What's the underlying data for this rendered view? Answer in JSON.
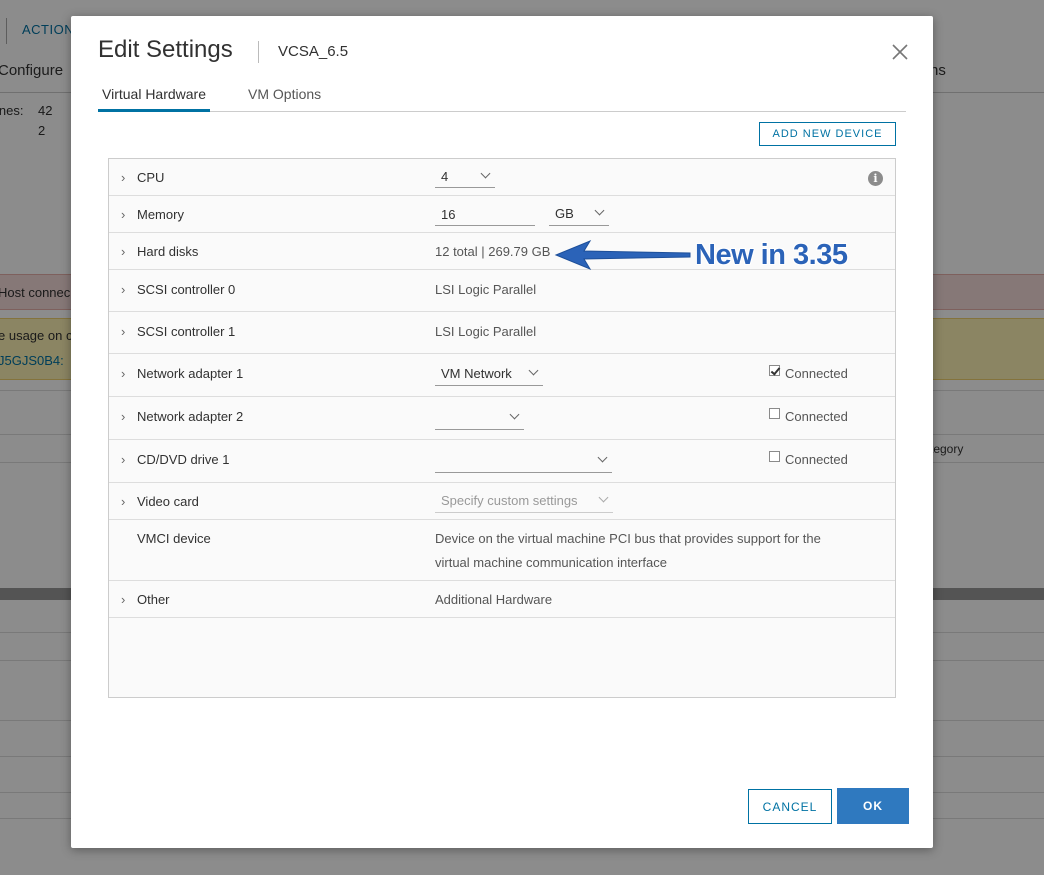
{
  "background": {
    "actions_label": "ACTION",
    "configure_tab": "Configure",
    "permissions_tab_fragment": "ns",
    "stat1_label": "ines:",
    "stat1_value": "42",
    "stat2_value": "2",
    "alert_red_text": "Host connec",
    "alert_yellow_text": "e usage on c",
    "alert_yellow_link": "J5GJS0B4:",
    "category_header": "tegory"
  },
  "modal": {
    "title": "Edit Settings",
    "subtitle": "VCSA_6.5",
    "close_icon": "close-icon",
    "tabs": [
      {
        "label": "Virtual Hardware",
        "active": true
      },
      {
        "label": "VM Options",
        "active": false
      }
    ],
    "add_device_label": "ADD NEW DEVICE",
    "hardware": {
      "cpu": {
        "label": "CPU",
        "value": "4"
      },
      "memory": {
        "label": "Memory",
        "value": "16",
        "unit": "GB"
      },
      "hard_disks": {
        "label": "Hard disks",
        "value": "12 total | 269.79 GB"
      },
      "scsi0": {
        "label": "SCSI controller 0",
        "value": "LSI Logic Parallel"
      },
      "scsi1": {
        "label": "SCSI controller 1",
        "value": "LSI Logic Parallel"
      },
      "net1": {
        "label": "Network adapter 1",
        "value": "VM Network",
        "connected_label": "Connected",
        "connected": true
      },
      "net2": {
        "label": "Network adapter 2",
        "value": "",
        "connected_label": "Connected",
        "connected": false
      },
      "cd": {
        "label": "CD/DVD drive 1",
        "value": "",
        "connected_label": "Connected",
        "connected": false
      },
      "video": {
        "label": "Video card",
        "value": "Specify custom settings"
      },
      "vmci": {
        "label": "VMCI device",
        "value_line1": "Device on the virtual machine PCI bus that provides support for the",
        "value_line2": "virtual machine communication interface"
      },
      "other": {
        "label": "Other",
        "value": "Additional Hardware"
      }
    },
    "annotation": "New in 3.35",
    "cancel_label": "CANCEL",
    "ok_label": "OK"
  },
  "colors": {
    "accent": "#0072a3",
    "ok_button": "#2f79bf",
    "annotation": "#2b63b8"
  }
}
